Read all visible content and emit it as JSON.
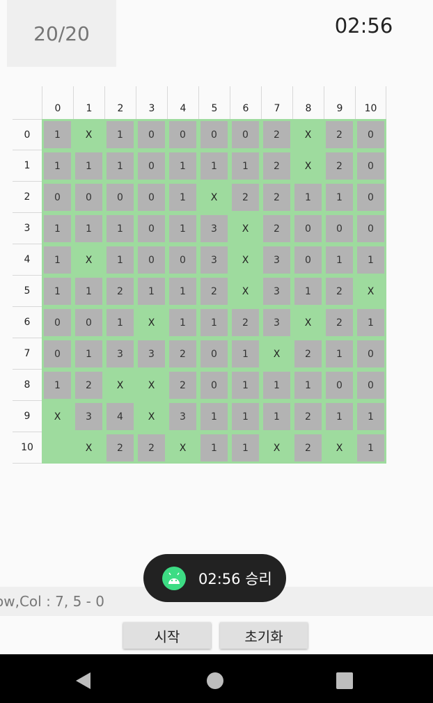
{
  "header": {
    "counter": "20/20",
    "timer": "02:56"
  },
  "board": {
    "col_labels": [
      "0",
      "1",
      "2",
      "3",
      "4",
      "5",
      "6",
      "7",
      "8",
      "9",
      "10"
    ],
    "row_labels": [
      "0",
      "1",
      "2",
      "3",
      "4",
      "5",
      "6",
      "7",
      "8",
      "9",
      "10"
    ],
    "rows": [
      [
        {
          "v": "1",
          "open": false
        },
        {
          "v": "X",
          "open": true
        },
        {
          "v": "1",
          "open": false
        },
        {
          "v": "0",
          "open": false
        },
        {
          "v": "0",
          "open": false
        },
        {
          "v": "0",
          "open": false
        },
        {
          "v": "0",
          "open": false
        },
        {
          "v": "2",
          "open": false
        },
        {
          "v": "X",
          "open": true
        },
        {
          "v": "2",
          "open": false
        },
        {
          "v": "0",
          "open": false
        }
      ],
      [
        {
          "v": "1",
          "open": false
        },
        {
          "v": "1",
          "open": false
        },
        {
          "v": "1",
          "open": false
        },
        {
          "v": "0",
          "open": false
        },
        {
          "v": "1",
          "open": false
        },
        {
          "v": "1",
          "open": false
        },
        {
          "v": "1",
          "open": false
        },
        {
          "v": "2",
          "open": false
        },
        {
          "v": "X",
          "open": true
        },
        {
          "v": "2",
          "open": false
        },
        {
          "v": "0",
          "open": false
        }
      ],
      [
        {
          "v": "0",
          "open": false
        },
        {
          "v": "0",
          "open": false
        },
        {
          "v": "0",
          "open": false
        },
        {
          "v": "0",
          "open": false
        },
        {
          "v": "1",
          "open": false
        },
        {
          "v": "X",
          "open": true
        },
        {
          "v": "2",
          "open": false
        },
        {
          "v": "2",
          "open": false
        },
        {
          "v": "1",
          "open": false
        },
        {
          "v": "1",
          "open": false
        },
        {
          "v": "0",
          "open": false
        }
      ],
      [
        {
          "v": "1",
          "open": false
        },
        {
          "v": "1",
          "open": false
        },
        {
          "v": "1",
          "open": false
        },
        {
          "v": "0",
          "open": false
        },
        {
          "v": "1",
          "open": false
        },
        {
          "v": "3",
          "open": false
        },
        {
          "v": "X",
          "open": true
        },
        {
          "v": "2",
          "open": false
        },
        {
          "v": "0",
          "open": false
        },
        {
          "v": "0",
          "open": false
        },
        {
          "v": "0",
          "open": false
        }
      ],
      [
        {
          "v": "1",
          "open": false
        },
        {
          "v": "X",
          "open": true
        },
        {
          "v": "1",
          "open": false
        },
        {
          "v": "0",
          "open": false
        },
        {
          "v": "0",
          "open": false
        },
        {
          "v": "3",
          "open": false
        },
        {
          "v": "X",
          "open": true
        },
        {
          "v": "3",
          "open": false
        },
        {
          "v": "0",
          "open": false
        },
        {
          "v": "1",
          "open": false
        },
        {
          "v": "1",
          "open": false
        }
      ],
      [
        {
          "v": "1",
          "open": false
        },
        {
          "v": "1",
          "open": false
        },
        {
          "v": "2",
          "open": false
        },
        {
          "v": "1",
          "open": false
        },
        {
          "v": "1",
          "open": false
        },
        {
          "v": "2",
          "open": false
        },
        {
          "v": "X",
          "open": true
        },
        {
          "v": "3",
          "open": false
        },
        {
          "v": "1",
          "open": false
        },
        {
          "v": "2",
          "open": false
        },
        {
          "v": "X",
          "open": true
        }
      ],
      [
        {
          "v": "0",
          "open": false
        },
        {
          "v": "0",
          "open": false
        },
        {
          "v": "1",
          "open": false
        },
        {
          "v": "X",
          "open": true
        },
        {
          "v": "1",
          "open": false
        },
        {
          "v": "1",
          "open": false
        },
        {
          "v": "2",
          "open": false
        },
        {
          "v": "3",
          "open": false
        },
        {
          "v": "X",
          "open": true
        },
        {
          "v": "2",
          "open": false
        },
        {
          "v": "1",
          "open": false
        }
      ],
      [
        {
          "v": "0",
          "open": false
        },
        {
          "v": "1",
          "open": false
        },
        {
          "v": "3",
          "open": false
        },
        {
          "v": "3",
          "open": false
        },
        {
          "v": "2",
          "open": false
        },
        {
          "v": "0",
          "open": false
        },
        {
          "v": "1",
          "open": false
        },
        {
          "v": "X",
          "open": true
        },
        {
          "v": "2",
          "open": false
        },
        {
          "v": "1",
          "open": false
        },
        {
          "v": "0",
          "open": false
        }
      ],
      [
        {
          "v": "1",
          "open": false
        },
        {
          "v": "2",
          "open": false
        },
        {
          "v": "X",
          "open": true
        },
        {
          "v": "X",
          "open": true
        },
        {
          "v": "2",
          "open": false
        },
        {
          "v": "0",
          "open": false
        },
        {
          "v": "1",
          "open": false
        },
        {
          "v": "1",
          "open": false
        },
        {
          "v": "1",
          "open": false
        },
        {
          "v": "0",
          "open": false
        },
        {
          "v": "0",
          "open": false
        }
      ],
      [
        {
          "v": "X",
          "open": true
        },
        {
          "v": "3",
          "open": false
        },
        {
          "v": "4",
          "open": false
        },
        {
          "v": "X",
          "open": true
        },
        {
          "v": "3",
          "open": false
        },
        {
          "v": "1",
          "open": false
        },
        {
          "v": "1",
          "open": false
        },
        {
          "v": "1",
          "open": false
        },
        {
          "v": "2",
          "open": false
        },
        {
          "v": "1",
          "open": false
        },
        {
          "v": "1",
          "open": false
        }
      ],
      [
        {
          "v": "",
          "open": true
        },
        {
          "v": "X",
          "open": true
        },
        {
          "v": "2",
          "open": false
        },
        {
          "v": "2",
          "open": false
        },
        {
          "v": "X",
          "open": true
        },
        {
          "v": "1",
          "open": false
        },
        {
          "v": "1",
          "open": false
        },
        {
          "v": "X",
          "open": true
        },
        {
          "v": "2",
          "open": false
        },
        {
          "v": "X",
          "open": true
        },
        {
          "v": "1",
          "open": false
        }
      ]
    ]
  },
  "toast": {
    "text": "02:56 승리",
    "icon": "android-icon"
  },
  "status": {
    "text": "ow,Col : 7, 5 - 0"
  },
  "buttons": {
    "start": "시작",
    "reset": "초기화"
  },
  "nav": {
    "back": "back-icon",
    "home": "home-icon",
    "recent": "recents-icon"
  },
  "colors": {
    "open_cell": "#9edb9e",
    "closed_tile": "#b3b3b3",
    "toast_bg": "#222222",
    "android_green": "#3ddc84"
  }
}
